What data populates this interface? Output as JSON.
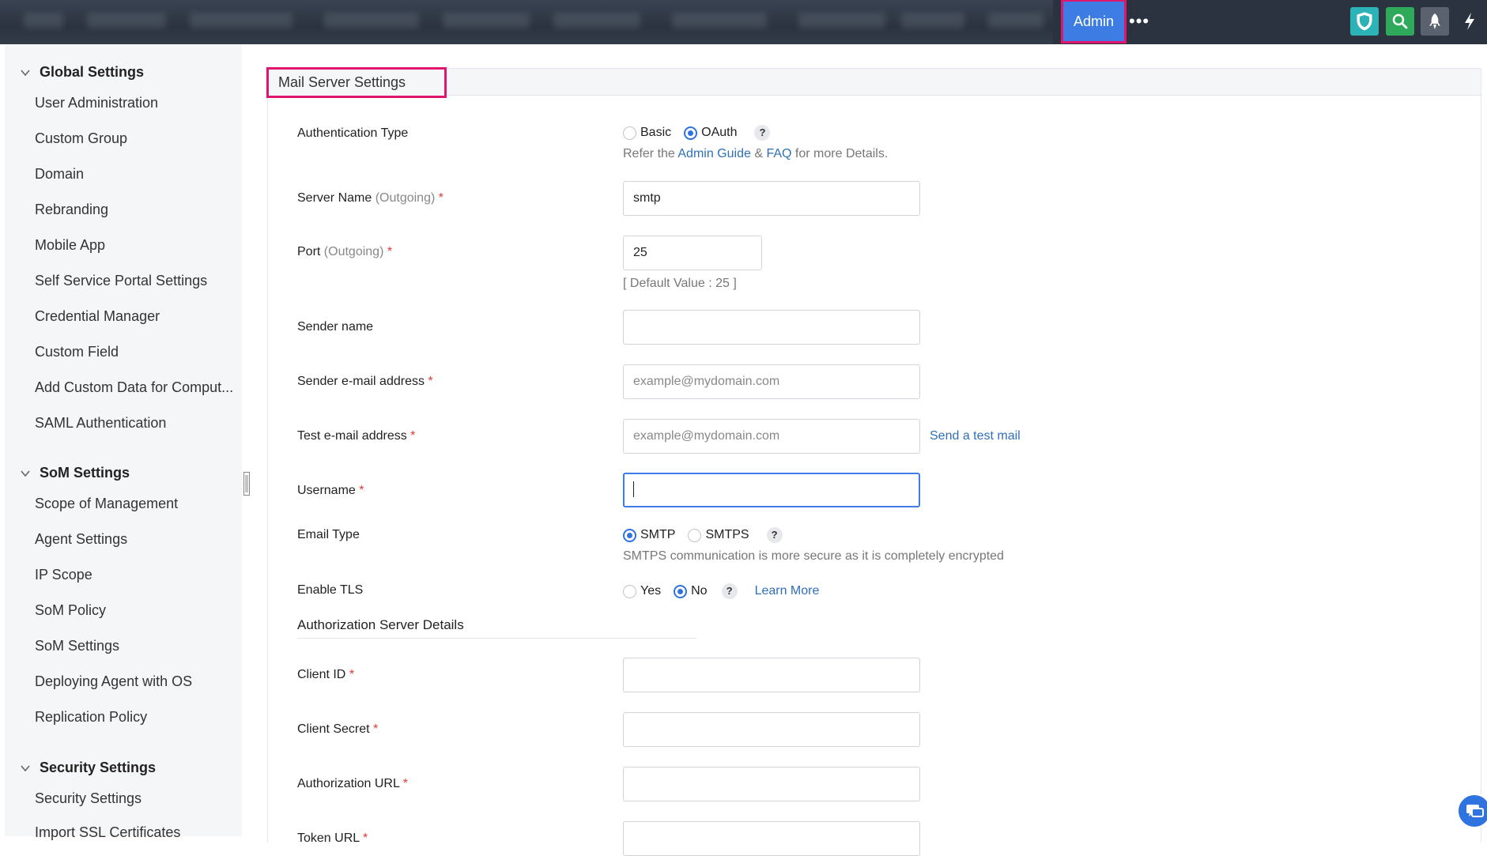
{
  "topbar": {
    "admin_label": "Admin",
    "more_label": "•••",
    "icons": [
      "shield-icon",
      "search-icon",
      "rocket-icon",
      "bolt-icon"
    ]
  },
  "sidebar": {
    "sections": [
      {
        "title": "Global Settings",
        "items": [
          "User Administration",
          "Custom Group",
          "Domain",
          "Rebranding",
          "Mobile App",
          "Self Service Portal Settings",
          "Credential Manager",
          "Custom Field",
          "Add Custom Data for Comput...",
          "SAML Authentication"
        ]
      },
      {
        "title": "SoM Settings",
        "items": [
          "Scope of Management",
          "Agent Settings",
          "IP Scope",
          "SoM Policy",
          "SoM Settings",
          "Deploying Agent with OS",
          "Replication Policy"
        ]
      },
      {
        "title": "Security Settings",
        "items": [
          "Security Settings",
          "Import SSL Certificates"
        ]
      }
    ]
  },
  "main": {
    "title": "Mail Server Settings",
    "auth_type": {
      "label": "Authentication Type",
      "options": [
        "Basic",
        "OAuth"
      ],
      "selected": "OAuth",
      "help": "?",
      "refer_prefix": "Refer the",
      "admin_guide_link": "Admin Guide",
      "amp": "&",
      "faq_link": "FAQ",
      "refer_suffix": "for more Details."
    },
    "server_name": {
      "label": "Server Name",
      "qualifier": "(Outgoing)",
      "req": "*",
      "value": "smtp"
    },
    "port": {
      "label": "Port",
      "qualifier": "(Outgoing)",
      "req": "*",
      "value": "25",
      "hint": "[ Default Value : 25 ]"
    },
    "sender_name": {
      "label": "Sender name",
      "value": ""
    },
    "sender_email": {
      "label": "Sender e-mail address",
      "req": "*",
      "placeholder": "example@mydomain.com"
    },
    "test_email": {
      "label": "Test e-mail address",
      "req": "*",
      "placeholder": "example@mydomain.com",
      "action": "Send a test mail"
    },
    "username": {
      "label": "Username",
      "req": "*",
      "value": ""
    },
    "email_type": {
      "label": "Email Type",
      "options": [
        "SMTP",
        "SMTPS"
      ],
      "selected": "SMTP",
      "help": "?",
      "hint": "SMTPS communication is more secure as it is completely encrypted"
    },
    "enable_tls": {
      "label": "Enable TLS",
      "options": [
        "Yes",
        "No"
      ],
      "selected": "No",
      "help": "?",
      "learn_more": "Learn More"
    },
    "auth_server_heading": "Authorization Server Details",
    "client_id": {
      "label": "Client ID",
      "req": "*"
    },
    "client_secret": {
      "label": "Client Secret",
      "req": "*"
    },
    "authorization_url": {
      "label": "Authorization URL",
      "req": "*"
    },
    "token_url": {
      "label": "Token URL",
      "req": "*"
    }
  }
}
